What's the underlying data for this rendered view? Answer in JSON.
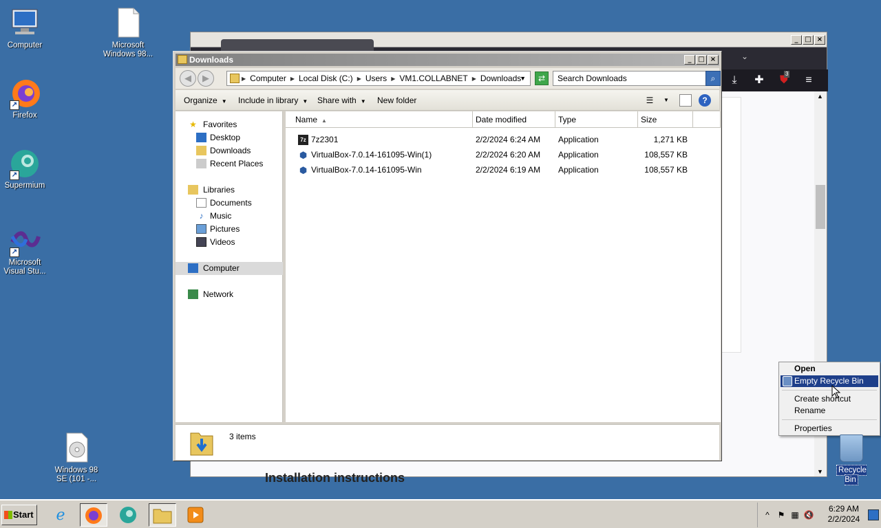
{
  "desktop": {
    "icons": [
      {
        "label": "Computer"
      },
      {
        "label": "Microsoft Windows 98..."
      },
      {
        "label": "Firefox"
      },
      {
        "label": "Supermium"
      },
      {
        "label": "Microsoft Visual Stu..."
      },
      {
        "label": "Windows 98 SE (101 -..."
      },
      {
        "label": "Recycle Bin"
      }
    ]
  },
  "browser": {
    "page_heading": "Installation instructions",
    "badge_count": "3"
  },
  "explorer": {
    "title": "Downloads",
    "breadcrumbs": [
      "Computer",
      "Local Disk (C:)",
      "Users",
      "VM1.COLLABNET",
      "Downloads"
    ],
    "search_placeholder": "Search Downloads",
    "commands": {
      "organize": "Organize",
      "include": "Include in library",
      "share": "Share with",
      "new_folder": "New folder"
    },
    "nav": {
      "favorites": "Favorites",
      "desktop": "Desktop",
      "downloads": "Downloads",
      "recent": "Recent Places",
      "libraries": "Libraries",
      "documents": "Documents",
      "music": "Music",
      "pictures": "Pictures",
      "videos": "Videos",
      "computer": "Computer",
      "network": "Network"
    },
    "columns": {
      "name": "Name",
      "date": "Date modified",
      "type": "Type",
      "size": "Size"
    },
    "files": [
      {
        "name": "7z2301",
        "date": "2/2/2024 6:24 AM",
        "type": "Application",
        "size": "1,271 KB",
        "icon": "7z-icon"
      },
      {
        "name": "VirtualBox-7.0.14-161095-Win(1)",
        "date": "2/2/2024 6:20 AM",
        "type": "Application",
        "size": "108,557 KB",
        "icon": "virtualbox-icon"
      },
      {
        "name": "VirtualBox-7.0.14-161095-Win",
        "date": "2/2/2024 6:19 AM",
        "type": "Application",
        "size": "108,557 KB",
        "icon": "virtualbox-icon"
      }
    ],
    "status": "3 items"
  },
  "context_menu": {
    "items": [
      "Open",
      "Empty Recycle Bin",
      "Create shortcut",
      "Rename",
      "Properties"
    ]
  },
  "taskbar": {
    "start": "Start",
    "time": "6:29 AM",
    "date": "2/2/2024"
  }
}
